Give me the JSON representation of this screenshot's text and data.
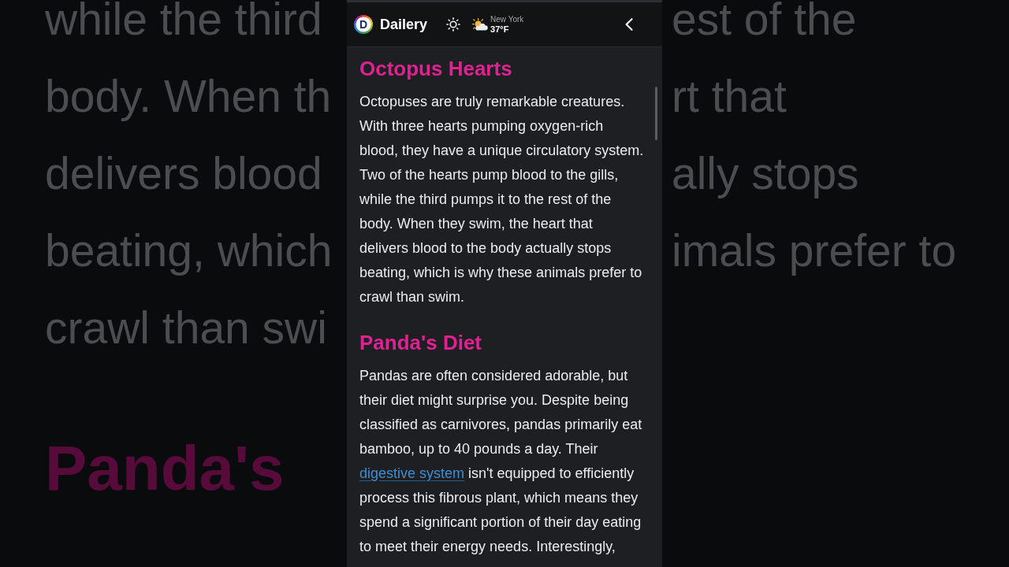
{
  "backdrop": {
    "left": [
      {
        "text": "while the third",
        "kind": "body"
      },
      {
        "text": "body. When th",
        "kind": "body"
      },
      {
        "text": "delivers blood",
        "kind": "body"
      },
      {
        "text": "beating, which",
        "kind": "body"
      },
      {
        "text": "crawl than swi",
        "kind": "body"
      },
      {
        "text": "Panda's",
        "kind": "heading"
      }
    ],
    "right": [
      {
        "text": "est of the",
        "kind": "body"
      },
      {
        "text": "rt that",
        "kind": "body"
      },
      {
        "text": "ally stops",
        "kind": "body"
      },
      {
        "text": "imals prefer to",
        "kind": "body"
      }
    ]
  },
  "header": {
    "logo_letter": "D",
    "app_name": "Dailery",
    "weather": {
      "city": "New York",
      "temperature": "37°F"
    }
  },
  "articles": [
    {
      "title": "Octopus Hearts",
      "body": [
        {
          "kind": "plain",
          "text": "Octopuses are truly remarkable creatures. With three hearts pumping oxygen-rich blood, they have a unique circulatory system. Two of the hearts pump blood to the gills, while the third pumps it to the rest of the body. When they swim, the heart that delivers blood to the body actually stops beating, which is why these animals prefer to crawl than swim."
        }
      ]
    },
    {
      "title": "Panda's Diet",
      "body": [
        {
          "kind": "plain",
          "text": "Pandas are often considered adorable, but their diet might surprise you. Despite being classified as carnivores, pandas primarily eat bamboo, up to 40 pounds a day. Their "
        },
        {
          "kind": "link",
          "text": "digestive system"
        },
        {
          "kind": "plain",
          "text": " isn't equipped to efficiently process this fibrous plant, which means they spend a significant portion of their day eating to meet their energy needs. Interestingly,"
        }
      ]
    }
  ]
}
